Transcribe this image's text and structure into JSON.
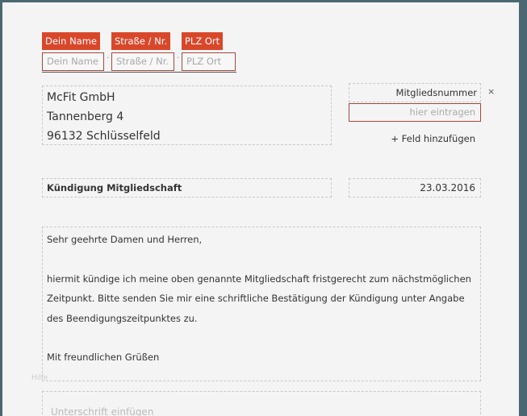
{
  "sender": {
    "labels": [
      "Dein Name",
      "Straße / Nr.",
      "PLZ Ort"
    ],
    "placeholders": [
      "Dein Name",
      "Straße / Nr.",
      "PLZ Ort"
    ],
    "separator": "·"
  },
  "recipient": {
    "lines": [
      "McFit GmbH",
      "Tannenberg 4",
      "96132 Schlüsselfeld"
    ]
  },
  "fields": {
    "label": "Mitgliedsnummer",
    "placeholder": "hier eintragen",
    "remove": "×",
    "add": "+ Feld hinzufügen"
  },
  "subject": "Kündigung Mitgliedschaft",
  "date": "23.03.2016",
  "body": {
    "greeting": "Sehr geehrte Damen und Herren,",
    "paragraph": "hiermit kündige ich meine oben genannte Mitgliedschaft fristgerecht zum nächstmöglichen Zeitpunkt. Bitte senden Sie mir eine schriftliche Bestätigung der Kündigung unter Angabe des Beendigungszeitpunktes zu.",
    "closing": "Mit freundlichen Grüßen"
  },
  "help": "Hilfe",
  "signature": "Unterschrift einfügen"
}
